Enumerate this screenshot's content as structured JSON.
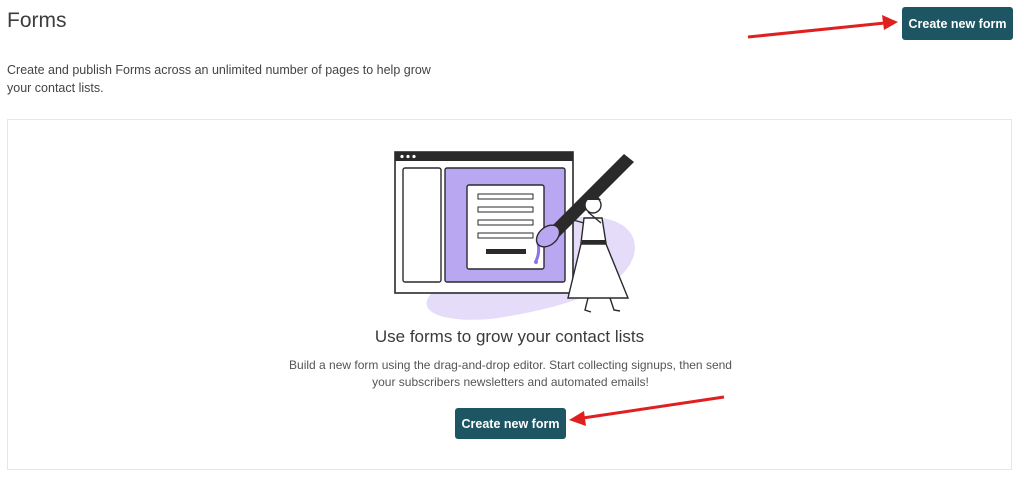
{
  "header": {
    "title": "Forms",
    "description": "Create and publish Forms across an unlimited number of pages to help grow your contact lists.",
    "create_button_label": "Create new form"
  },
  "empty_state": {
    "illustration": "form-builder-illustration",
    "title": "Use forms to grow your contact lists",
    "description": "Build a new form using the drag-and-drop editor. Start collecting signups, then send your subscribers newsletters and automated emails!",
    "create_button_label": "Create new form"
  },
  "annotations": {
    "arrow_color": "#e02020"
  },
  "colors": {
    "button_bg": "#1e5563",
    "accent_purple": "#b9a7f2",
    "illustration_blob": "#e4dcf9"
  }
}
